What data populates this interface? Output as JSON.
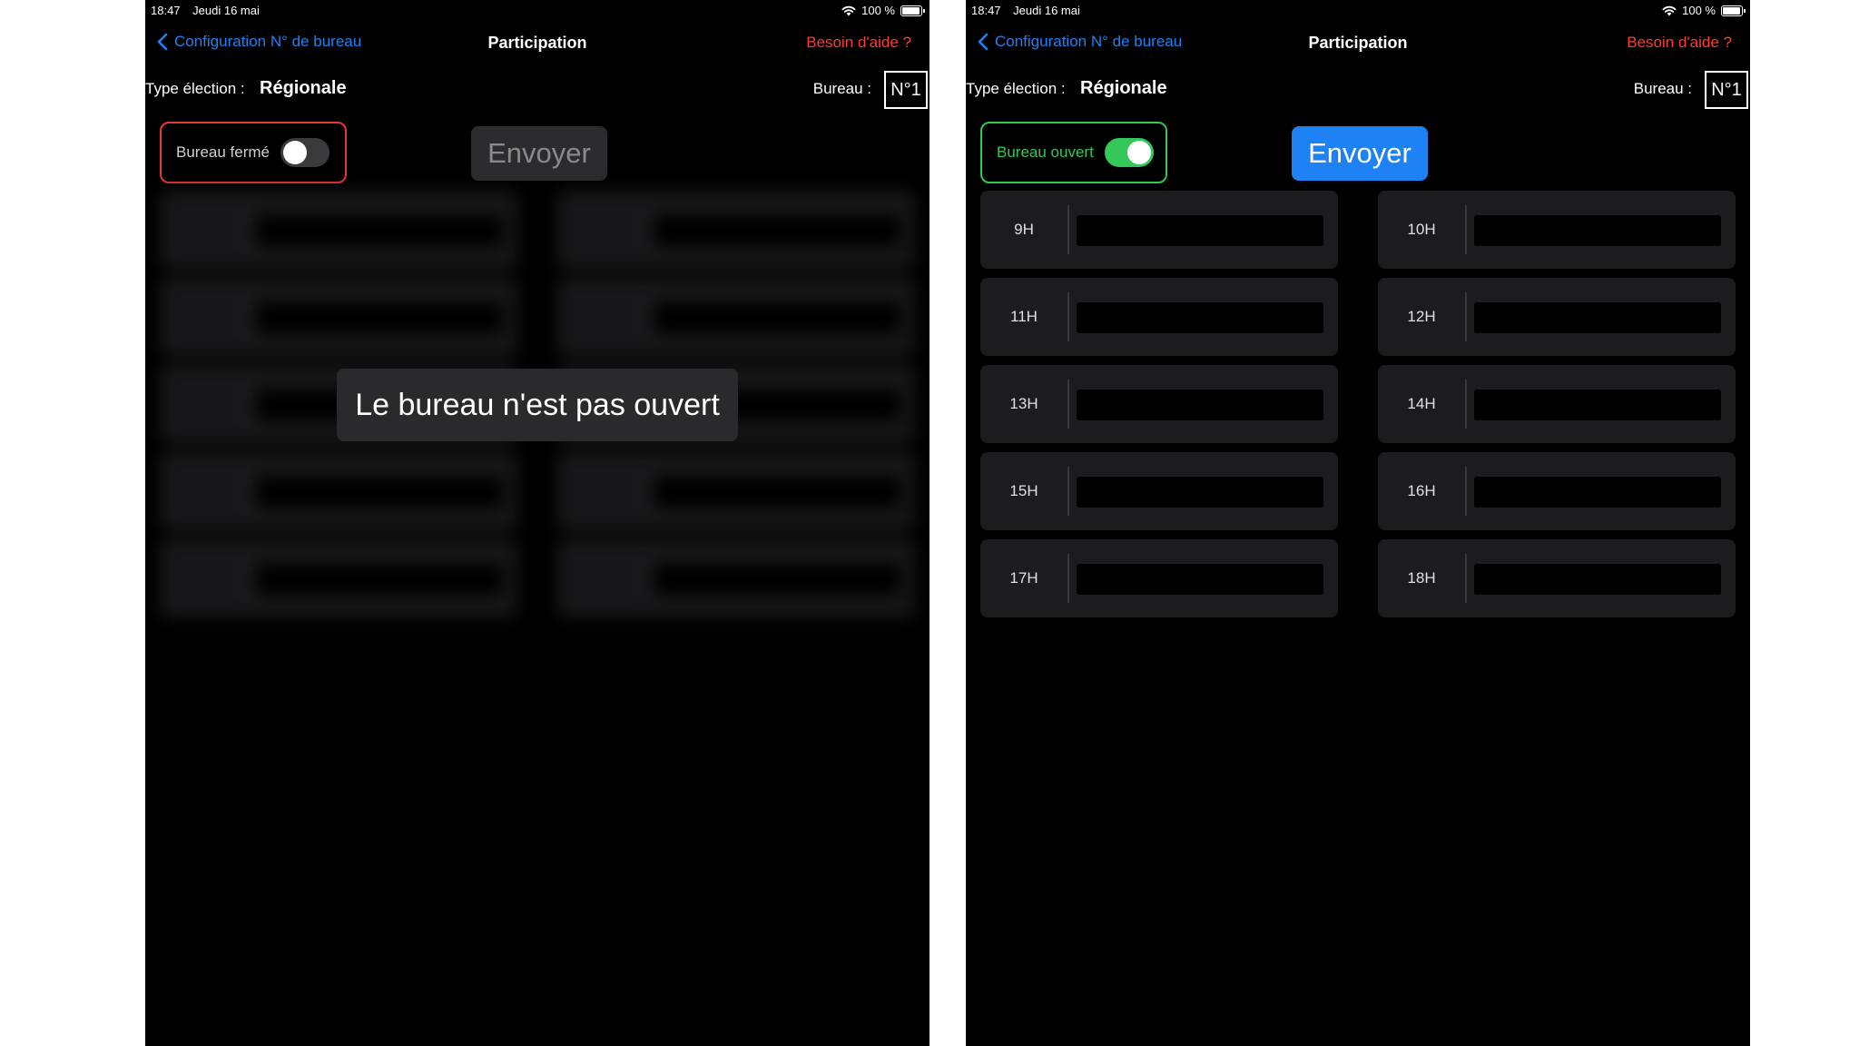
{
  "screens": [
    {
      "state": "closed",
      "status_bar": {
        "time": "18:47",
        "date": "Jeudi 16 mai",
        "battery": "100 %"
      },
      "nav": {
        "back_label": "Configuration N° de bureau",
        "title": "Participation",
        "help_label": "Besoin d'aide ?"
      },
      "info": {
        "type_label": "Type élection :",
        "type_value": "Régionale",
        "bureau_label": "Bureau :",
        "bureau_value": "N°1"
      },
      "toggle": {
        "label": "Bureau fermé",
        "on": false
      },
      "send_label": "Envoyer",
      "overlay_message": "Le bureau n'est pas ouvert"
    },
    {
      "state": "open",
      "status_bar": {
        "time": "18:47",
        "date": "Jeudi 16 mai",
        "battery": "100 %"
      },
      "nav": {
        "back_label": "Configuration N° de bureau",
        "title": "Participation",
        "help_label": "Besoin d'aide ?"
      },
      "info": {
        "type_label": "Type élection :",
        "type_value": "Régionale",
        "bureau_label": "Bureau :",
        "bureau_value": "N°1"
      },
      "toggle": {
        "label": "Bureau ouvert",
        "on": true
      },
      "send_label": "Envoyer",
      "slots": [
        {
          "label": "9H",
          "value": ""
        },
        {
          "label": "10H",
          "value": ""
        },
        {
          "label": "11H",
          "value": ""
        },
        {
          "label": "12H",
          "value": ""
        },
        {
          "label": "13H",
          "value": ""
        },
        {
          "label": "14H",
          "value": ""
        },
        {
          "label": "15H",
          "value": ""
        },
        {
          "label": "16H",
          "value": ""
        },
        {
          "label": "17H",
          "value": ""
        },
        {
          "label": "18H",
          "value": ""
        }
      ]
    }
  ],
  "colors": {
    "accent_blue": "#1e82f5",
    "help_red": "#ff3b30",
    "closed_border": "#e53935",
    "open_green": "#34c759",
    "background": "#000000",
    "cell_background": "#1c1c1e"
  }
}
